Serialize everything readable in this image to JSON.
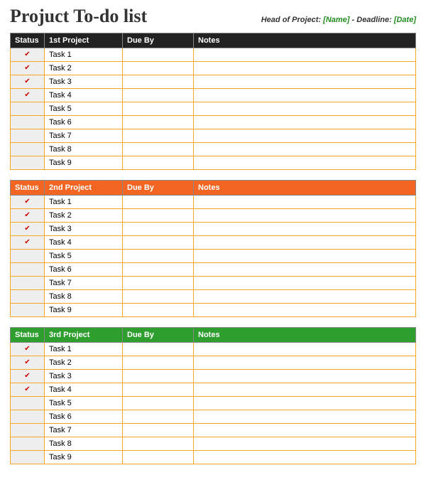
{
  "title": "Projuct To-do list",
  "meta": {
    "head_label": "Head of Project:",
    "head_value": "[Name]",
    "sep": " - ",
    "deadline_label": "Deadline:",
    "deadline_value": "[Date]"
  },
  "columns": {
    "status": "Status",
    "due": "Due By",
    "notes": "Notes"
  },
  "sections": [
    {
      "id": "project1",
      "header_class": "hdr-black",
      "name_header": "1st Project",
      "rows": [
        {
          "checked": true,
          "name": "Task 1",
          "due": "",
          "notes": ""
        },
        {
          "checked": true,
          "name": "Task 2",
          "due": "",
          "notes": ""
        },
        {
          "checked": true,
          "name": "Task 3",
          "due": "",
          "notes": ""
        },
        {
          "checked": true,
          "name": "Task 4",
          "due": "",
          "notes": ""
        },
        {
          "checked": false,
          "name": "Task 5",
          "due": "",
          "notes": ""
        },
        {
          "checked": false,
          "name": "Task 6",
          "due": "",
          "notes": ""
        },
        {
          "checked": false,
          "name": "Task 7",
          "due": "",
          "notes": ""
        },
        {
          "checked": false,
          "name": "Task 8",
          "due": "",
          "notes": ""
        },
        {
          "checked": false,
          "name": "Task 9",
          "due": "",
          "notes": ""
        }
      ]
    },
    {
      "id": "project2",
      "header_class": "hdr-orange",
      "name_header": "2nd Project",
      "rows": [
        {
          "checked": true,
          "name": "Task 1",
          "due": "",
          "notes": ""
        },
        {
          "checked": true,
          "name": "Task 2",
          "due": "",
          "notes": ""
        },
        {
          "checked": true,
          "name": "Task 3",
          "due": "",
          "notes": ""
        },
        {
          "checked": true,
          "name": "Task 4",
          "due": "",
          "notes": ""
        },
        {
          "checked": false,
          "name": "Task 5",
          "due": "",
          "notes": ""
        },
        {
          "checked": false,
          "name": "Task 6",
          "due": "",
          "notes": ""
        },
        {
          "checked": false,
          "name": "Task 7",
          "due": "",
          "notes": ""
        },
        {
          "checked": false,
          "name": "Task 8",
          "due": "",
          "notes": ""
        },
        {
          "checked": false,
          "name": "Task 9",
          "due": "",
          "notes": ""
        }
      ]
    },
    {
      "id": "project3",
      "header_class": "hdr-green",
      "name_header": "3rd Project",
      "rows": [
        {
          "checked": true,
          "name": "Task 1",
          "due": "",
          "notes": ""
        },
        {
          "checked": true,
          "name": "Task 2",
          "due": "",
          "notes": ""
        },
        {
          "checked": true,
          "name": "Task 3",
          "due": "",
          "notes": ""
        },
        {
          "checked": true,
          "name": "Task 4",
          "due": "",
          "notes": ""
        },
        {
          "checked": false,
          "name": "Task 5",
          "due": "",
          "notes": ""
        },
        {
          "checked": false,
          "name": "Task 6",
          "due": "",
          "notes": ""
        },
        {
          "checked": false,
          "name": "Task 7",
          "due": "",
          "notes": ""
        },
        {
          "checked": false,
          "name": "Task 8",
          "due": "",
          "notes": ""
        },
        {
          "checked": false,
          "name": "Task 9",
          "due": "",
          "notes": ""
        }
      ]
    }
  ]
}
